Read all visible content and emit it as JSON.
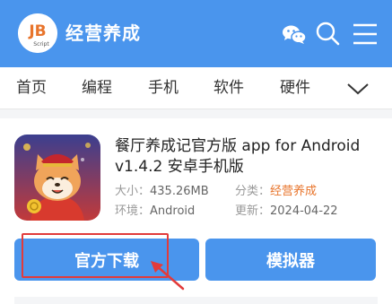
{
  "header": {
    "logo_text": "JB",
    "logo_subtext": "Script",
    "title": "经营养成",
    "icons": [
      "wechat-icon",
      "search-icon",
      "menu-icon"
    ]
  },
  "nav": {
    "items": [
      {
        "label": "首页"
      },
      {
        "label": "编程"
      },
      {
        "label": "手机"
      },
      {
        "label": "软件"
      },
      {
        "label": "硬件"
      }
    ],
    "more_icon": "chevron-down-icon"
  },
  "app": {
    "title": "餐厅养成记官方版 app for Android v1.4.2 安卓手机版",
    "size_label": "大小：",
    "size_value": "435.26MB",
    "category_label": "分类：",
    "category_value": "经营养成",
    "env_label": "环境：",
    "env_value": "Android",
    "updated_label": "更新：",
    "updated_value": "2024-04-22"
  },
  "buttons": {
    "download_label": "官方下载",
    "emulator_label": "模拟器"
  },
  "colors": {
    "brand": "#4a95ed",
    "accent": "#e8742b",
    "highlight": "#e23b3b"
  }
}
